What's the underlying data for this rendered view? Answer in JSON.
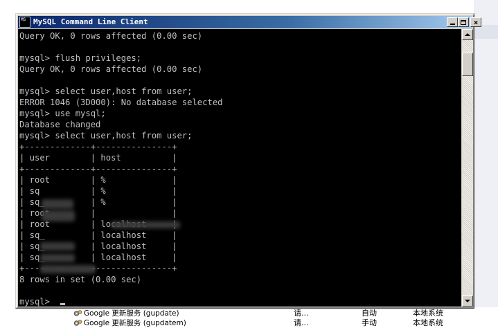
{
  "window": {
    "title": "MySQL Command Line Client",
    "icon_text": "MS",
    "icon": "console-app-icon",
    "buttons": {
      "minimize": "minimize-icon",
      "maximize": "maximize-icon",
      "close": "×"
    },
    "colors": {
      "titlebar": "#0a246a",
      "console_bg": "#000000",
      "console_fg": "#c0c0c0",
      "chrome": "#d4d0c8"
    }
  },
  "console": {
    "lines": [
      "Query OK, 0 rows affected (0.00 sec)",
      "",
      "mysql> flush privileges;",
      "Query OK, 0 rows affected (0.00 sec)",
      "",
      "mysql> select user,host from user;",
      "ERROR 1046 (3D000): No database selected",
      "mysql> use mysql;",
      "Database changed",
      "mysql> select user,host from user;",
      "+-------------+---------------+",
      "| user        | host          |",
      "+-------------+---------------+",
      "| root        | %             |",
      "| sq          | %             |",
      "| sq_         | %             |",
      "| root        |               |",
      "| root        | localhost     |",
      "| sq_         | localhost     |",
      "| sq_         | localhost     |",
      "| sq_         | localhost     |",
      "+-------------+---------------+",
      "8 rows in set (0.00 sec)",
      "",
      "mysql> "
    ]
  },
  "scrollbar": {
    "up": "scroll-up-arrow-icon",
    "down": "scroll-down-arrow-icon"
  },
  "services": [
    {
      "name": "Google 更新服务 (gupdate)",
      "description": "请...",
      "startup": "自动",
      "logon": "本地系统"
    },
    {
      "name": "Google 更新服务 (gupdatem)",
      "description": "请...",
      "startup": "手动",
      "logon": "本地系统"
    }
  ]
}
